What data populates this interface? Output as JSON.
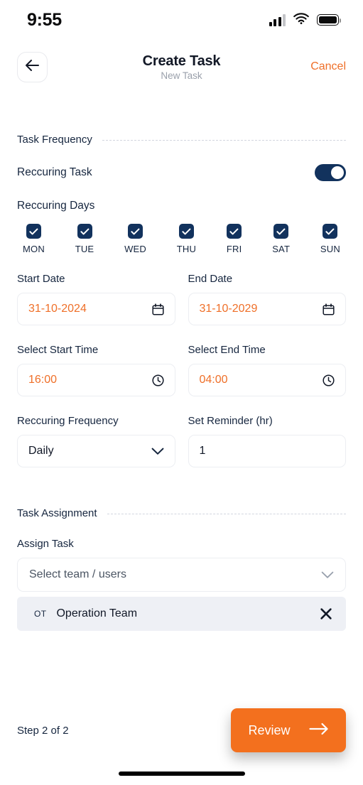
{
  "status_bar": {
    "time": "9:55",
    "signal_icon": "cellular-signal-icon",
    "wifi_icon": "wifi-icon",
    "battery_icon": "battery-full-icon"
  },
  "header": {
    "back_icon": "arrow-left-icon",
    "title": "Create Task",
    "subtitle": "New Task",
    "cancel_label": "Cancel"
  },
  "task_frequency": {
    "section_label": "Task Frequency",
    "recurring_task_label": "Reccuring Task",
    "recurring_task_enabled": true,
    "recurring_days_label": "Reccuring Days",
    "days": [
      {
        "label": "MON",
        "checked": true
      },
      {
        "label": "TUE",
        "checked": true
      },
      {
        "label": "WED",
        "checked": true
      },
      {
        "label": "THU",
        "checked": true
      },
      {
        "label": "FRI",
        "checked": true
      },
      {
        "label": "SAT",
        "checked": true
      },
      {
        "label": "SUN",
        "checked": true
      }
    ],
    "start_date": {
      "label": "Start Date",
      "value": "31-10-2024",
      "icon": "calendar-icon"
    },
    "end_date": {
      "label": "End Date",
      "value": "31-10-2029",
      "icon": "calendar-icon"
    },
    "start_time": {
      "label": "Select Start Time",
      "value": "16:00",
      "icon": "clock-icon"
    },
    "end_time": {
      "label": "Select End Time",
      "value": "04:00",
      "icon": "clock-icon"
    },
    "recurring_frequency": {
      "label": "Reccuring Frequency",
      "value": "Daily",
      "icon": "chevron-down-icon"
    },
    "set_reminder": {
      "label": "Set Reminder (hr)",
      "value": "1"
    }
  },
  "task_assignment": {
    "section_label": "Task Assignment",
    "assign_task_label": "Assign Task",
    "select_placeholder": "Select team / users",
    "select_icon": "chevron-down-icon",
    "assigned": [
      {
        "initials": "OT",
        "name": "Operation Team",
        "remove_icon": "close-icon"
      }
    ]
  },
  "footer": {
    "step_text": "Step 2 of 2",
    "review_label": "Review",
    "review_icon": "arrow-right-icon"
  },
  "colors": {
    "accent_orange": "#f3701e",
    "navy": "#12325d",
    "text_dark": "#16263f",
    "chip_bg": "#eef0f5",
    "border": "#eceef2"
  }
}
